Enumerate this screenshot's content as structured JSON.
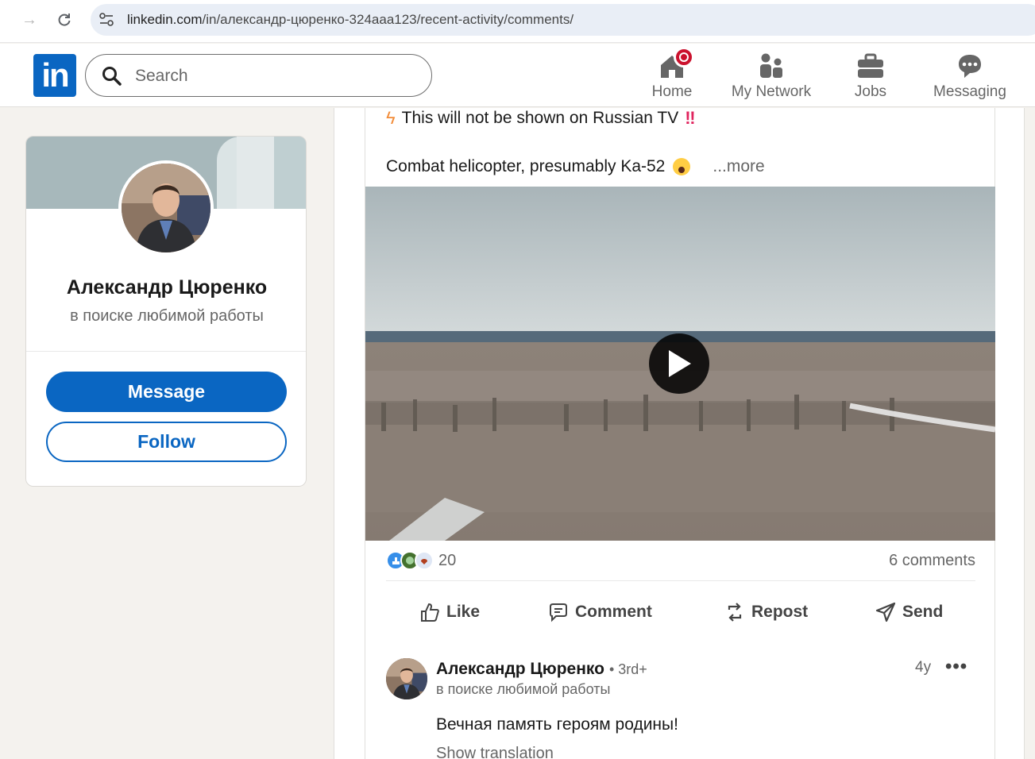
{
  "browser": {
    "url_host": "linkedin.com",
    "url_path": "/in/александр-цюренко-324aaa123/recent-activity/comments/"
  },
  "header": {
    "logo_text": "in",
    "search_placeholder": "Search",
    "nav": [
      {
        "label": "Home",
        "icon": "home-icon",
        "has_badge": true
      },
      {
        "label": "My Network",
        "icon": "network-icon"
      },
      {
        "label": "Jobs",
        "icon": "briefcase-icon"
      },
      {
        "label": "Messaging",
        "icon": "messaging-icon"
      }
    ]
  },
  "profile_card": {
    "name": "Александр Цюренко",
    "tagline": "в поиске любимой работы",
    "message_label": "Message",
    "follow_label": "Follow"
  },
  "post": {
    "line1": "This will not be shown on Russian TV",
    "line1_prefix_icon": "lightning-icon",
    "line1_suffix": "‼️",
    "line2": "Combat helicopter, presumably Ka-52",
    "line2_emoji": "scared-face-emoji",
    "more_label": "...more",
    "reactions_count": "20",
    "comments_count": "6 comments",
    "actions": {
      "like": "Like",
      "comment": "Comment",
      "repost": "Repost",
      "send": "Send"
    }
  },
  "comment": {
    "author": "Александр Цюренко",
    "degree": "• 3rd+",
    "tagline": "в поиске любимой работы",
    "time": "4y",
    "menu": "•••",
    "text": "Вечная память героям родины!",
    "translation_label": "Show translation"
  },
  "colors": {
    "brand": "#0a66c2",
    "badge": "#cb112d",
    "background": "#f4f2ee"
  }
}
